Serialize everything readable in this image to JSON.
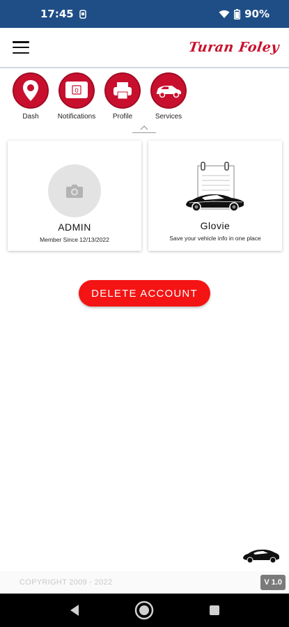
{
  "status_bar": {
    "time": "17:45",
    "battery": "90%",
    "icons": [
      "notification-icon",
      "wifi-icon",
      "battery-icon"
    ]
  },
  "header": {
    "menu_icon": "hamburger-icon",
    "logo_text": "Turan Foley"
  },
  "nav": {
    "items": [
      {
        "label": "Dash",
        "icon": "map-pin-icon"
      },
      {
        "label": "Notifications",
        "icon": "notification-bell-icon",
        "count": "0"
      },
      {
        "label": "Profile",
        "icon": "printer-icon"
      },
      {
        "label": "Services",
        "icon": "car-icon"
      }
    ]
  },
  "cards": {
    "admin": {
      "title": "ADMIN",
      "subtitle": "Member Since 12/13/2022",
      "icon": "camera-icon"
    },
    "glovie": {
      "title": "Glovie",
      "subtitle": "Save your vehicle info in one place",
      "icon": "car-notepad-icon"
    }
  },
  "actions": {
    "delete_label": "DELETE ACCOUNT"
  },
  "footer": {
    "copyright": "COPYRIGHT 2009 - 2022",
    "version": "V 1.0"
  },
  "colors": {
    "accent": "#c8102e",
    "status_bar": "#1f4e87",
    "delete": "#f41414"
  }
}
